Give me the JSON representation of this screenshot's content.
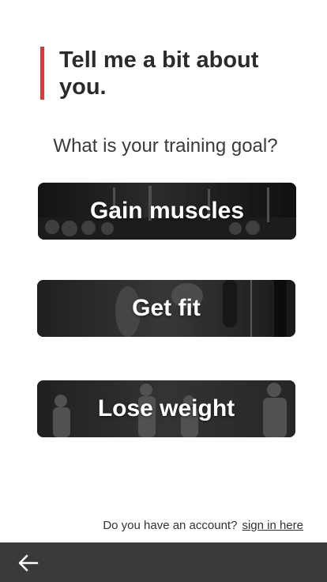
{
  "heading": {
    "line1": "Tell me a bit about",
    "line2": "you."
  },
  "question": "What is your training goal?",
  "goals": [
    {
      "label": "Gain muscles"
    },
    {
      "label": "Get fit"
    },
    {
      "label": "Lose weight"
    }
  ],
  "account": {
    "prompt": "Do you have an account?",
    "link": "sign in here"
  },
  "navigation": {
    "back_icon": "arrow-left-icon"
  },
  "colors": {
    "accent": "#d63b3b",
    "bottom_bar": "#3a3a3a",
    "card_bg": "#1c1c1c"
  }
}
